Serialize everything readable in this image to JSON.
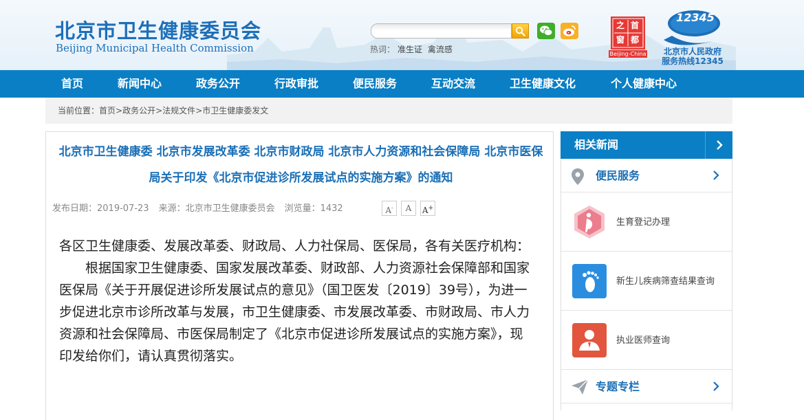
{
  "header": {
    "logo_cn": "北京市卫生健康委员会",
    "logo_en": "Beijing Municipal Health Commission",
    "search": {
      "placeholder": ""
    },
    "hot": {
      "label": "热词：",
      "keywords": [
        "准生证",
        "禽流感"
      ]
    },
    "stamp_line1": "之首",
    "stamp_line2": "窗都",
    "stamp_caption": "Beijing-China",
    "hotline_number": "12345",
    "hotline_line1": "北京市人民政府",
    "hotline_line2": "服务热线12345"
  },
  "nav": [
    "首页",
    "新闻中心",
    "政务公开",
    "行政审批",
    "便民服务",
    "互动交流",
    "卫生健康文化",
    "个人健康中心"
  ],
  "breadcrumb": {
    "label": "当前位置：",
    "items": [
      "首页",
      "政务公开",
      "法规文件",
      "市卫生健康委发文"
    ]
  },
  "article": {
    "title": "北京市卫生健康委 北京市发展改革委 北京市财政局 北京市人力资源和社会保障局 北京市医保局关于印发《北京市促进诊所发展试点的实施方案》的通知",
    "publish_date": "发布日期：2019-07-23",
    "source": "来源：北京市卫生健康委员会",
    "views": "浏览量：1432",
    "font_small": "A",
    "font_normal": "A",
    "font_large": "A",
    "greeting": "各区卫生健康委、发展改革委、财政局、人力社保局、医保局，各有关医疗机构：",
    "paragraph": "根据国家卫生健康委、国家发展改革委、财政部、人力资源社会保障部和国家医保局《关于开展促进诊所发展试点的意见》（国卫医发〔2019〕39号），为进一步促进北京市诊所改革与发展，市卫生健康委、市发展改革委、市财政局、市人力资源和社会保障局、市医保局制定了《北京市促进诊所发展试点的实施方案》，现印发给你们，请认真贯彻落实。"
  },
  "sidebar": {
    "related_news": "相关新闻",
    "convenience": "便民服务",
    "services": [
      "生育登记办理",
      "新生儿疾病筛查结果查询",
      "执业医师查询"
    ],
    "special": "专题专栏"
  }
}
